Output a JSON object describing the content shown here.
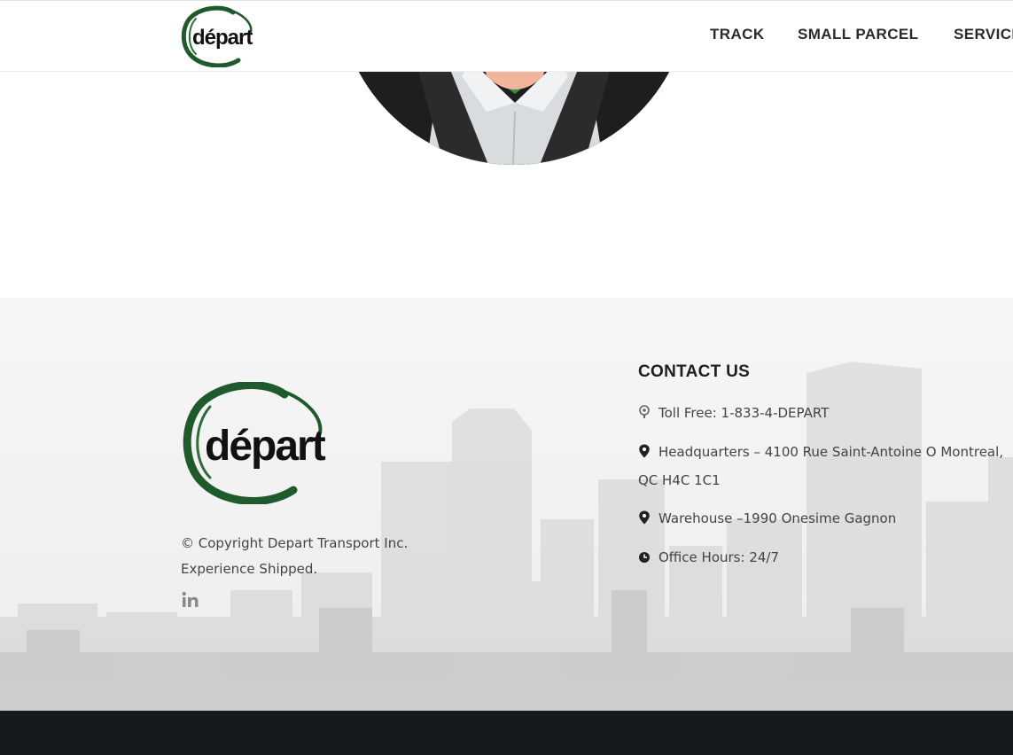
{
  "header": {
    "logo_text": "départ",
    "nav": [
      {
        "label": "TRACK"
      },
      {
        "label": "SMALL PARCEL"
      },
      {
        "label": "SERVICES"
      }
    ]
  },
  "footer": {
    "logo_text": "départ",
    "copyright_line1": "© Copyright Depart Transport Inc.",
    "copyright_line2": "Experience Shipped.",
    "contact": {
      "title": "CONTACT US",
      "toll_free": "Toll Free: 1-833-4-DEPART",
      "headquarters": "Headquarters – 4100 Rue Saint-Antoine O Montreal, QC H4C 1C1",
      "warehouse": "Warehouse –1990 Onesime Gagnon",
      "hours": "Office Hours: 24/7"
    }
  },
  "icons": {
    "social": "linkedin-icon",
    "phone": "phone-icon",
    "location": "map-pin-icon",
    "clock": "clock-icon"
  },
  "colors": {
    "brand_green": "#1f5a2c",
    "bottom_bar": "#16191d"
  }
}
